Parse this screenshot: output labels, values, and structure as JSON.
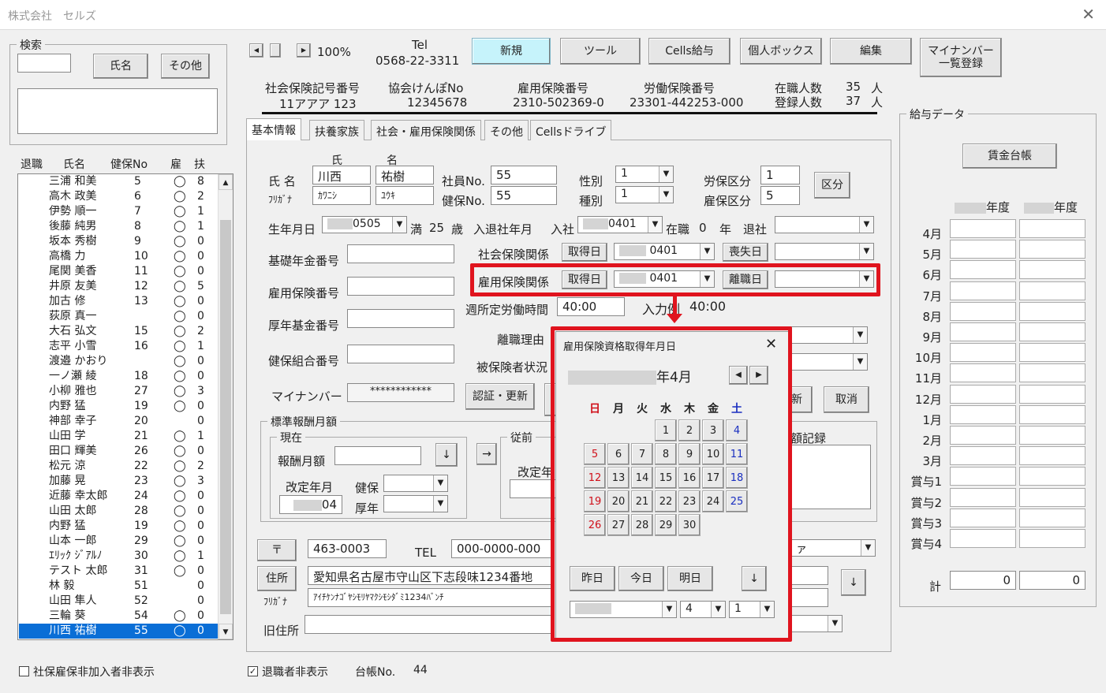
{
  "window": {
    "title": "株式会社　セルズ",
    "close": "✕"
  },
  "search": {
    "caption": "検索",
    "btn_name": "氏名",
    "btn_other": "その他"
  },
  "list_header": {
    "retired": "退職",
    "name": "氏名",
    "hno": "健保No",
    "emp": "雇",
    "dep": "扶"
  },
  "employees": [
    {
      "name": "三浦 和美",
      "no": "5",
      "e": "◯",
      "d": "8"
    },
    {
      "name": "高木 政美",
      "no": "6",
      "e": "◯",
      "d": "2"
    },
    {
      "name": "伊勢 順一",
      "no": "7",
      "e": "◯",
      "d": "1"
    },
    {
      "name": "後藤 純男",
      "no": "8",
      "e": "◯",
      "d": "1"
    },
    {
      "name": "坂本 秀樹",
      "no": "9",
      "e": "◯",
      "d": "0"
    },
    {
      "name": "高橋 力",
      "no": "10",
      "e": "◯",
      "d": "0"
    },
    {
      "name": "尾関 美香",
      "no": "11",
      "e": "◯",
      "d": "0"
    },
    {
      "name": "井原 友美",
      "no": "12",
      "e": "◯",
      "d": "5"
    },
    {
      "name": "加古 修",
      "no": "13",
      "e": "◯",
      "d": "0"
    },
    {
      "name": "荻原 真一",
      "no": "",
      "e": "◯",
      "d": "0"
    },
    {
      "name": "大石 弘文",
      "no": "15",
      "e": "◯",
      "d": "2"
    },
    {
      "name": "志平 小雪",
      "no": "16",
      "e": "◯",
      "d": "1"
    },
    {
      "name": "渡邉 かおり",
      "no": "",
      "e": "◯",
      "d": "0"
    },
    {
      "name": "一ノ瀬 綾",
      "no": "18",
      "e": "◯",
      "d": "0"
    },
    {
      "name": "小柳 雅也",
      "no": "27",
      "e": "◯",
      "d": "3"
    },
    {
      "name": "内野 猛",
      "no": "19",
      "e": "◯",
      "d": "0"
    },
    {
      "name": "神部 幸子",
      "no": "20",
      "e": "",
      "d": "0"
    },
    {
      "name": "山田 学",
      "no": "21",
      "e": "◯",
      "d": "1"
    },
    {
      "name": "田口 輝美",
      "no": "26",
      "e": "◯",
      "d": "0"
    },
    {
      "name": "松元 涼",
      "no": "22",
      "e": "◯",
      "d": "2"
    },
    {
      "name": "加藤 晃",
      "no": "23",
      "e": "◯",
      "d": "3"
    },
    {
      "name": "近藤 幸太郎",
      "no": "24",
      "e": "◯",
      "d": "0"
    },
    {
      "name": "山田 太郎",
      "no": "28",
      "e": "◯",
      "d": "0"
    },
    {
      "name": "内野 猛",
      "no": "19",
      "e": "◯",
      "d": "0"
    },
    {
      "name": "山本 一郎",
      "no": "29",
      "e": "◯",
      "d": "0"
    },
    {
      "name": "ｴﾘｯｸ ｼﾞｱﾙﾉ",
      "no": "30",
      "e": "◯",
      "d": "1"
    },
    {
      "name": "テスト 太郎",
      "no": "31",
      "e": "◯",
      "d": "0"
    },
    {
      "name": "林 毅",
      "no": "51",
      "e": "",
      "d": "0"
    },
    {
      "name": "山田 隼人",
      "no": "52",
      "e": "",
      "d": "0"
    },
    {
      "name": "三輪 葵",
      "no": "54",
      "e": "◯",
      "d": "0"
    },
    {
      "name": "川西 祐樹",
      "no": "55",
      "e": "◯",
      "d": "0"
    }
  ],
  "footer": {
    "chk1": "社保雇保非加入者非表示",
    "chk2": "退職者非表示",
    "ledger_label": "台帳No.",
    "ledger_no": "44",
    "check": "✓"
  },
  "nav": {
    "zoom": "100%",
    "left": "◀",
    "right": "▶"
  },
  "tel": {
    "label": "Tel",
    "number": "0568-22-3311"
  },
  "toolbar": {
    "new": "新規",
    "tool": "ツール",
    "salary": "Cells給与",
    "box": "個人ボックス",
    "edit": "編集",
    "mynumber_1": "マイナンバー",
    "mynumber_2": "一覧登録"
  },
  "company": {
    "l1": "社会保険記号番号",
    "v1": "11アアア 123",
    "l2": "協会けんぽNo",
    "v2": "12345678",
    "l3": "雇用保険番号",
    "v3": "2310-502369-0",
    "l4": "労働保険番号",
    "v4": "23301-442253-000",
    "l5": "在職人数",
    "v5": "35",
    "u5": "人",
    "l6": "登録人数",
    "v6": "37",
    "u6": "人"
  },
  "tabs": [
    "基本情報",
    "扶養家族",
    "社会・雇用保険関係",
    "その他",
    "Cellsドライブ"
  ],
  "basic": {
    "name_label": "氏 名",
    "kana_label": "ﾌﾘｶﾞﾅ",
    "sei_head": "氏",
    "mei_head": "名",
    "sei": "川西",
    "mei": "祐樹",
    "sei_kana": "ｶﾜﾆｼ",
    "mei_kana": "ﾕｳｷ",
    "emp_no_label": "社員No.",
    "emp_no": "55",
    "hno_label": "健保No.",
    "hno": "55",
    "gender_label": "性別",
    "gender": "1",
    "type_label": "種別",
    "type": "1",
    "rousai_label": "労保区分",
    "rousai": "1",
    "koyou_label": "雇保区分",
    "koyou": "5",
    "kubun_btn": "区分",
    "birth_label": "生年月日",
    "birth": "0505",
    "age_pre": "満",
    "age": "25",
    "age_unit": "歳",
    "join_label": "入退社年月",
    "join_in": "入社",
    "join": "0401",
    "tenure_label": "在職",
    "tenure": "0",
    "tenure_unit": "年",
    "leave_label": "退社",
    "pension_label": "基礎年金番号",
    "emp_ins_label": "雇用保険番号",
    "kousei_label": "厚年基金番号",
    "kenpo_label": "健保組合番号",
    "social_label": "社会保険関係",
    "acquire": "取得日",
    "social_date": "0401",
    "lose": "喪失日",
    "koyo_label": "雇用保険関係",
    "koyo_date": "0401",
    "rishoku": "離職日",
    "hours_label": "週所定労働時間",
    "hours": "40:00",
    "input_label": "入力例",
    "input_ex": "40:00",
    "reason_label": "離職理由",
    "status_label": "被保険者状況",
    "mynumber_label": "マイナンバー",
    "mynumber": "************",
    "auth_btn": "認証・更新",
    "renew": "新",
    "cancel": "取消"
  },
  "standard": {
    "caption": "標準報酬月額",
    "current": "現在",
    "monthly": "報酬月額",
    "revise": "改定年月",
    "kenpo": "健保",
    "kounen": "厚年",
    "revise_val": "04",
    "prev": "従前",
    "prev_revise": "改定年",
    "record": "額記録",
    "down": "↓",
    "right": "→"
  },
  "address": {
    "zip_btn": "〒",
    "zip": "463-0003",
    "tel_label": "TEL",
    "tel": "000-0000-000",
    "addr_btn": "住所",
    "addr": "愛知県名古屋市守山区下志段味1234番地",
    "kana_label": "ﾌﾘｶﾞﾅ",
    "kana": "ｱｲﾁｹﾝﾅｺﾞﾔｼﾓﾘﾔﾏｸｼﾓｼﾀﾞﾐ1234ﾊﾞﾝﾁ",
    "old_label": "旧住所",
    "katakana_tail": "ァ",
    "down": "↓"
  },
  "calendar": {
    "title": "雇用保険資格取得年月日",
    "close": "✕",
    "month": "年4月",
    "prev": "◀",
    "next": "▶",
    "weekdays": [
      "日",
      "月",
      "火",
      "水",
      "木",
      "金",
      "土"
    ],
    "days": [
      "1",
      "2",
      "3",
      "4",
      "5",
      "6",
      "7",
      "8",
      "9",
      "10",
      "11",
      "12",
      "13",
      "14",
      "15",
      "16",
      "17",
      "18",
      "19",
      "20",
      "21",
      "22",
      "23",
      "24",
      "25",
      "26",
      "27",
      "28",
      "29",
      "30"
    ],
    "yesterday": "昨日",
    "today": "今日",
    "tomorrow": "明日",
    "down": "↓",
    "sel_month": "4",
    "sel_day": "1"
  },
  "salary": {
    "caption": "給与データ",
    "ledger_btn": "賃金台帳",
    "year_label": "年度",
    "months": [
      "4月",
      "5月",
      "6月",
      "7月",
      "8月",
      "9月",
      "10月",
      "11月",
      "12月",
      "1月",
      "2月",
      "3月",
      "賞与1",
      "賞与2",
      "賞与3",
      "賞与4"
    ],
    "total_label": "計",
    "total1": "0",
    "total2": "0"
  },
  "colors": {
    "highlight": "#e0141e",
    "selected": "#0a6ed6",
    "new_btn": "#c6f3fb",
    "sunday": "#d0101a",
    "saturday": "#1a2fc0"
  }
}
